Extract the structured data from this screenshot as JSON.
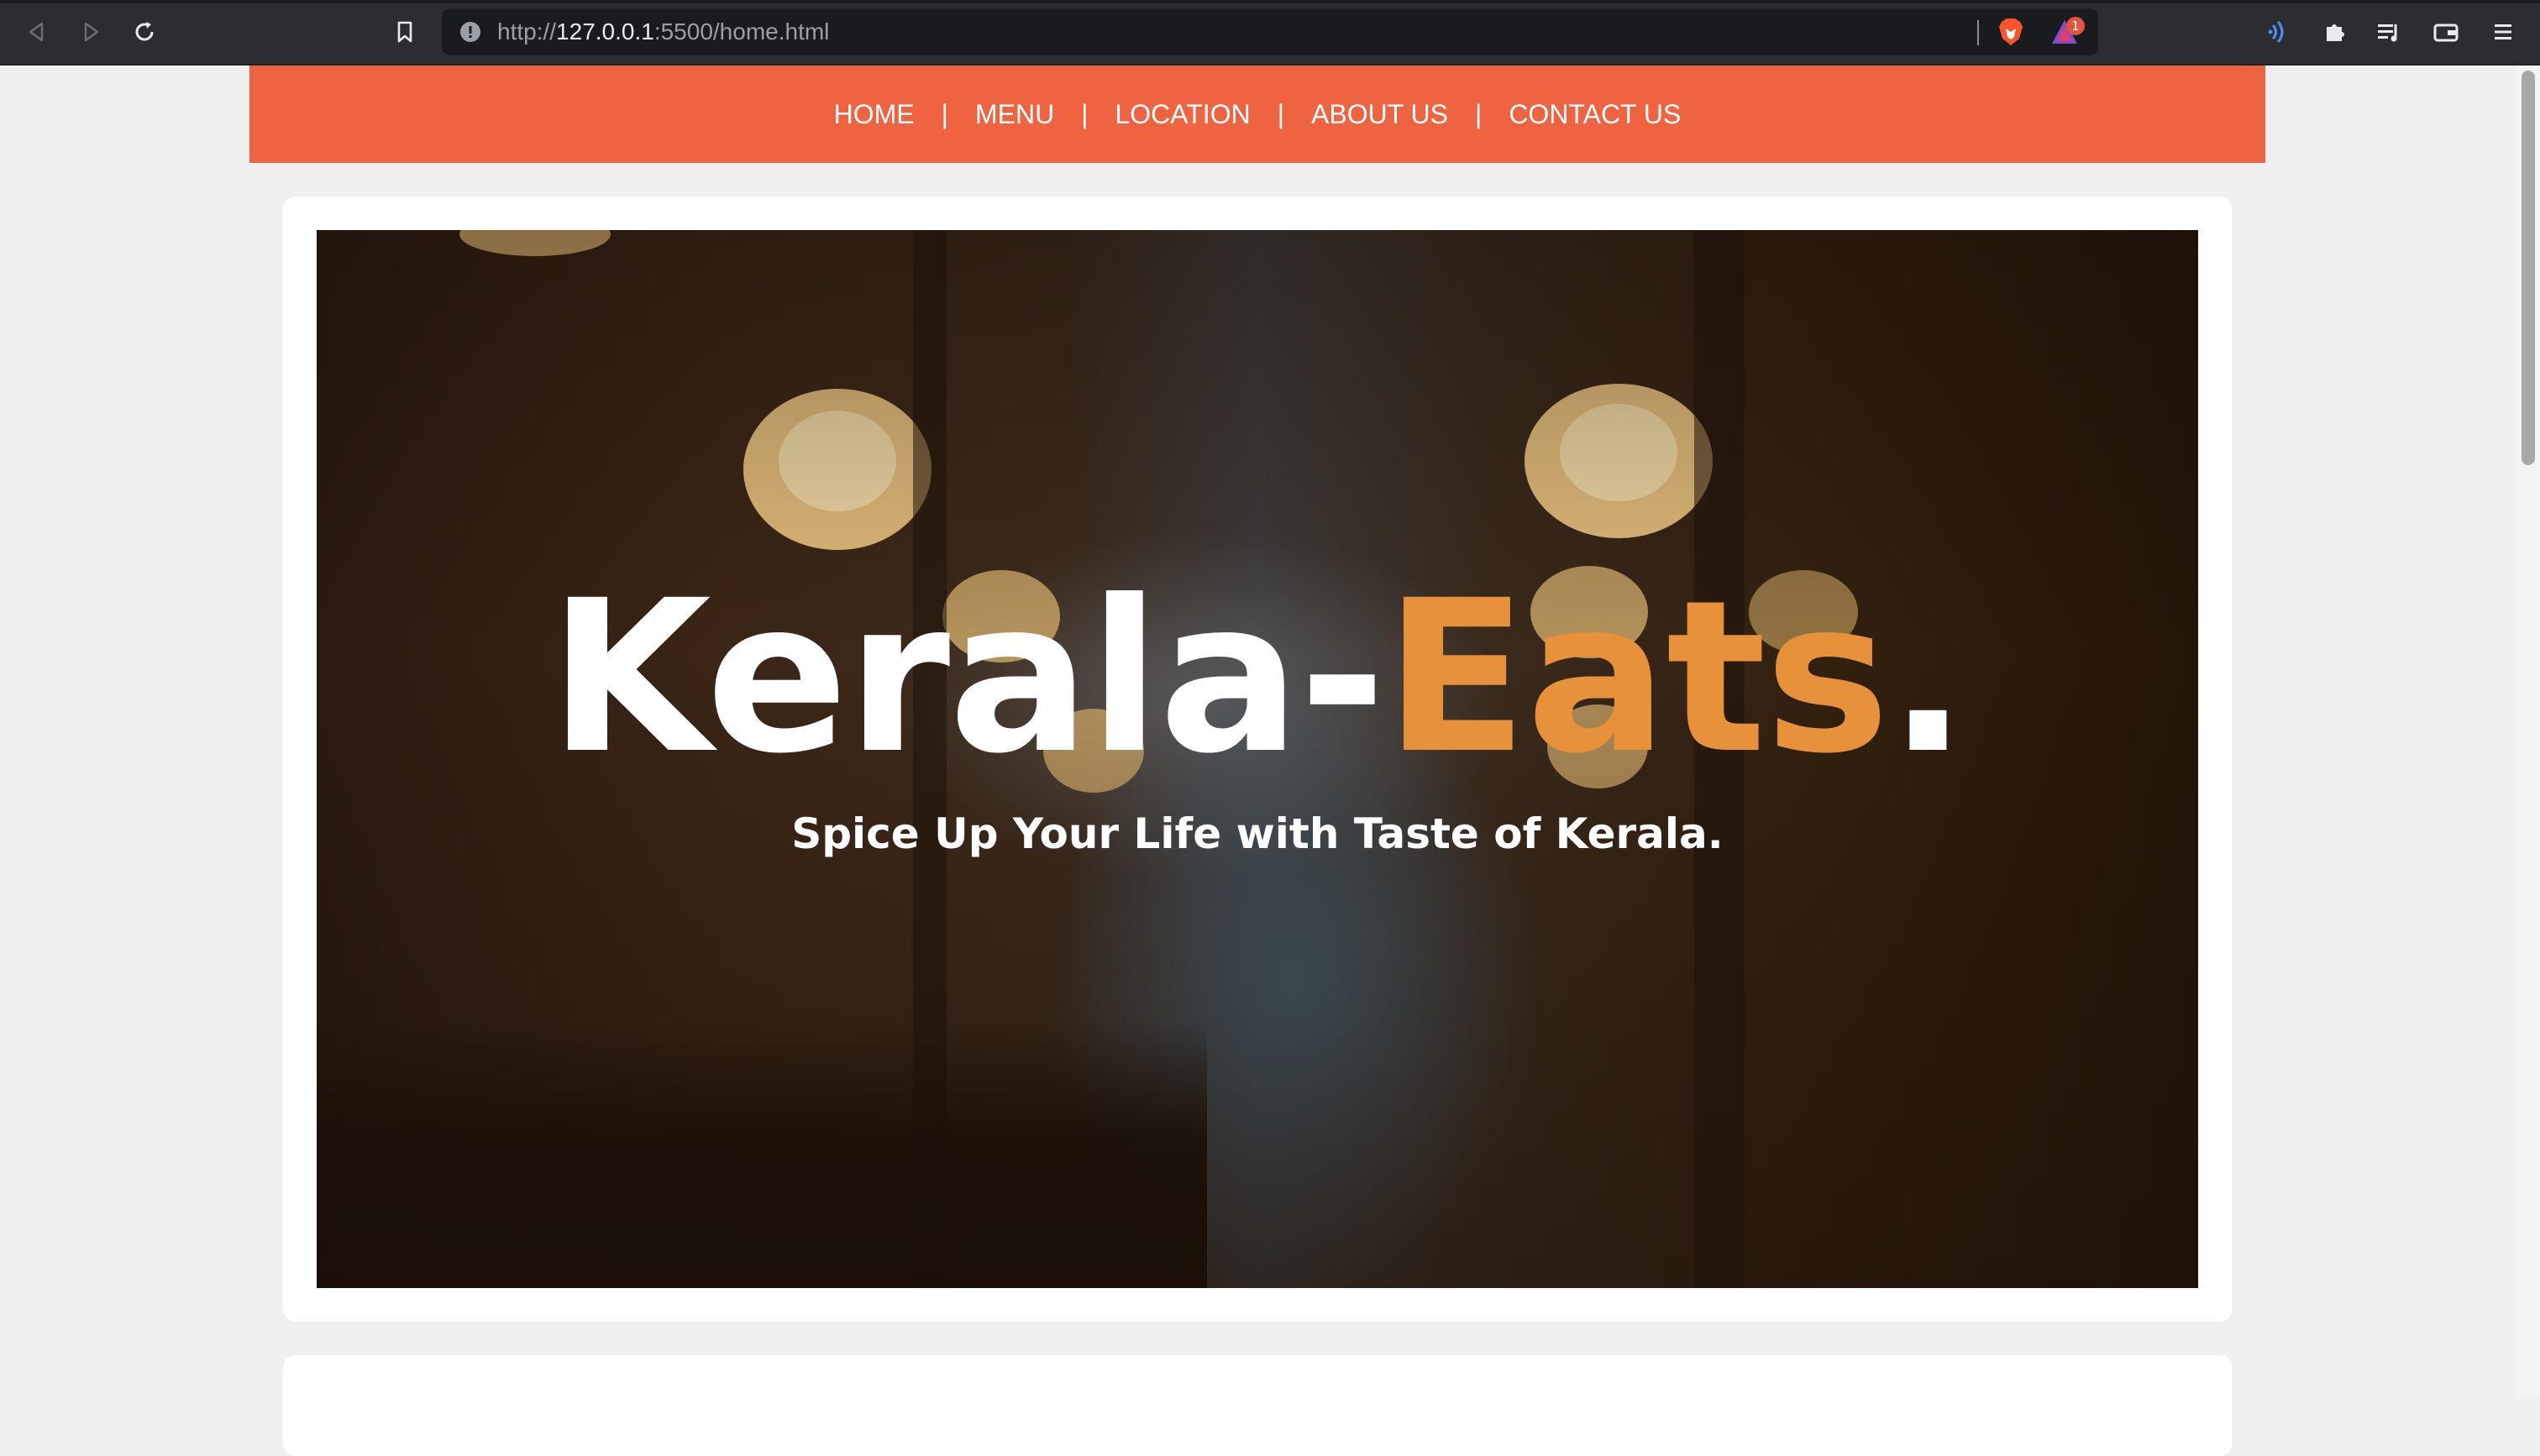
{
  "browser": {
    "url_prefix": "http://",
    "url_host": "127.0.0.1",
    "url_rest": ":5500/home.html",
    "notification_count": "1"
  },
  "nav": {
    "items": [
      "HOME",
      "MENU",
      "LOCATION",
      "ABOUT US",
      "CONTACT US"
    ],
    "separator": "|",
    "background": "#ee6340"
  },
  "hero": {
    "title_main": "Kerala-",
    "title_accent": "Eats",
    "title_dot": ".",
    "subtitle": "Spice Up Your Life with Taste of Kerala.",
    "accent_color": "#e8913b"
  }
}
